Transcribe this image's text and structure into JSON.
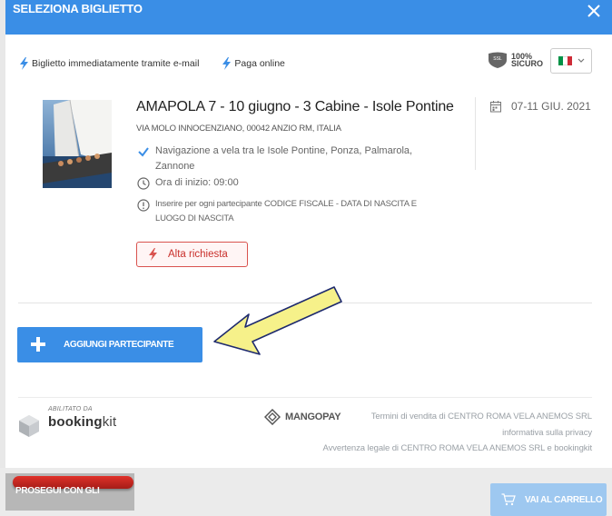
{
  "header": {
    "title": "SELEZIONA BIGLIETTO"
  },
  "features": [
    {
      "label": "Biglietto immediatamente tramite e-mail"
    },
    {
      "label": "Paga online"
    }
  ],
  "security_badge": {
    "top": "100%",
    "bottom": "SICURO",
    "ssl": "SSL"
  },
  "event": {
    "title": "AMAPOLA 7 - 10 giugno - 3 Cabine - Isole Pontine",
    "address": "VIA MOLO INNOCENZIANO, 00042 ANZIO RM, ITALIA",
    "route_line1": "Navigazione a vela tra le Isole Pontine, Ponza, Palmarola,",
    "route_line2": "Zannone",
    "start_time": "Ora di inizio: 09:00",
    "notice_line1": "Inserire per ogni partecipante CODICE FISCALE - DATA DI NASCITA E",
    "notice_line2": "LUOGO DI NASCITA",
    "date": "07-11 GIU. 2021",
    "demand_badge": "Alta richiesta"
  },
  "actions": {
    "add_participant": "AGGIUNGI PARTECIPANTE",
    "continue": "PROSEGUI CON GLI",
    "go_to_cart": "VAI AL CARRELLO"
  },
  "footer": {
    "enabled_by": "ABILITATO DA",
    "brand_bold": "booking",
    "brand_light": "kit",
    "payment_provider": "MANGOPAY",
    "terms": "Termini di vendita di CENTRO ROMA VELA ANEMOS SRL",
    "privacy": "informativa sulla privacy",
    "legal": "Avvertenza legale di CENTRO ROMA VELA ANEMOS SRL e bookingkit"
  },
  "colors": {
    "primary": "#3a8ee6",
    "danger": "#d9534f",
    "annotation_arrow": "#f6f18a"
  }
}
